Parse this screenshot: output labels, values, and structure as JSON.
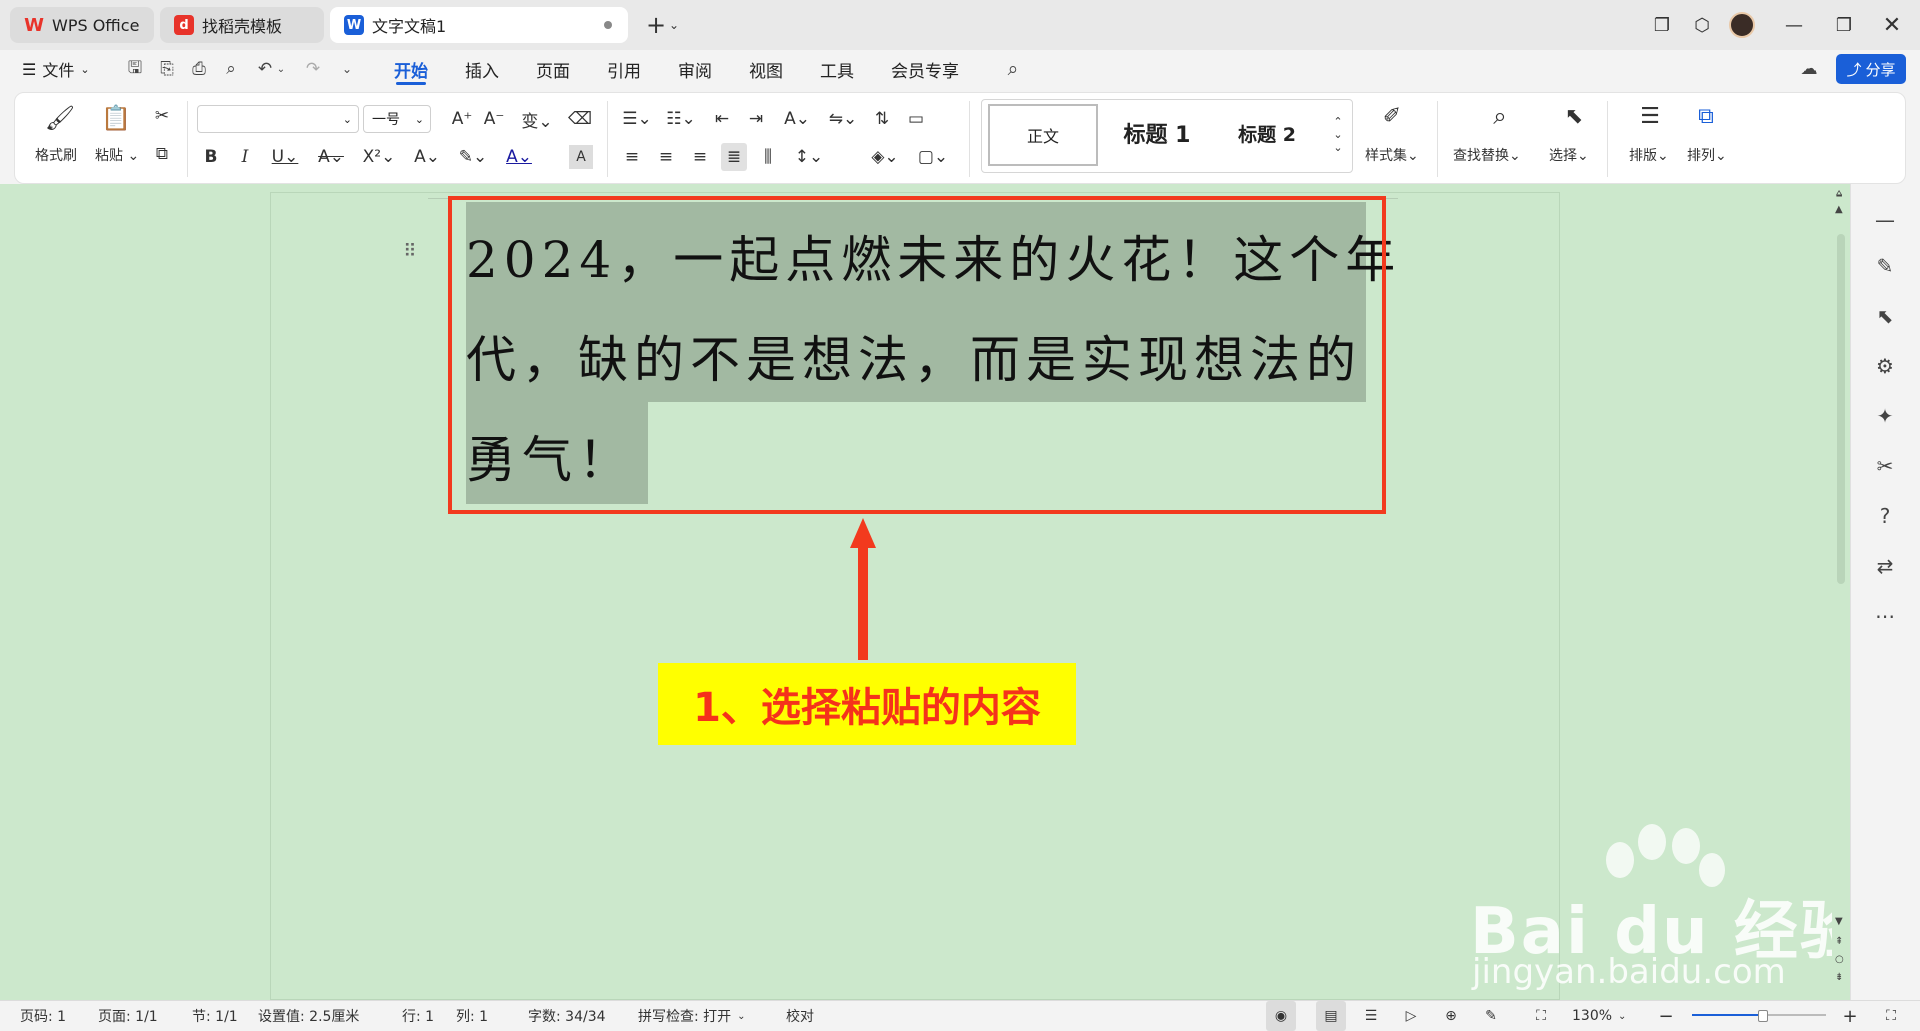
{
  "tabs": [
    {
      "label": "WPS Office",
      "icon": "wps-logo-icon",
      "color": "#e8332a"
    },
    {
      "label": "找稻壳模板",
      "icon": "docer-icon",
      "color": "#e8332a"
    },
    {
      "label": "文字文稿1",
      "icon": "word-doc-icon",
      "color": "#1a5fd8"
    }
  ],
  "menu": {
    "file_label": "文件",
    "items": [
      "开始",
      "插入",
      "页面",
      "引用",
      "审阅",
      "视图",
      "工具",
      "会员专享"
    ],
    "selected": "开始",
    "share_label": "分享"
  },
  "ribbon": {
    "format_painter": "格式刷",
    "paste": "粘贴",
    "font_name": "",
    "font_size": "一号",
    "styles": {
      "normal": "正文",
      "heading1": "标题 1",
      "heading2": "标题 2",
      "style_set": "样式集"
    },
    "find_replace": "查找替换",
    "select": "选择",
    "layout": "排版",
    "arrange": "排列"
  },
  "document": {
    "lines": [
      "2024，一起点燃未来的火花！这个年",
      "代，缺的不是想法，而是实现想法的",
      "勇气！"
    ]
  },
  "annotation": {
    "text": "1、选择粘贴的内容"
  },
  "statusbar": {
    "page_number": "页码: 1",
    "pages": "页面: 1/1",
    "section": "节: 1/1",
    "setting": "设置值: 2.5厘米",
    "row": "行: 1",
    "column": "列: 1",
    "word_count": "字数: 34/34",
    "spell_check": "拼写检查: 打开",
    "proofread": "校对",
    "zoom": "130%"
  },
  "watermark": {
    "brand": "Bai du 经验",
    "url": "jingyan.baidu.com"
  },
  "colors": {
    "accent": "#1a5fd8",
    "doc_bg": "#cce8cc",
    "highlight": "#a2b9a2",
    "red": "#f23a1e",
    "annotation_bg": "#ffff00"
  }
}
